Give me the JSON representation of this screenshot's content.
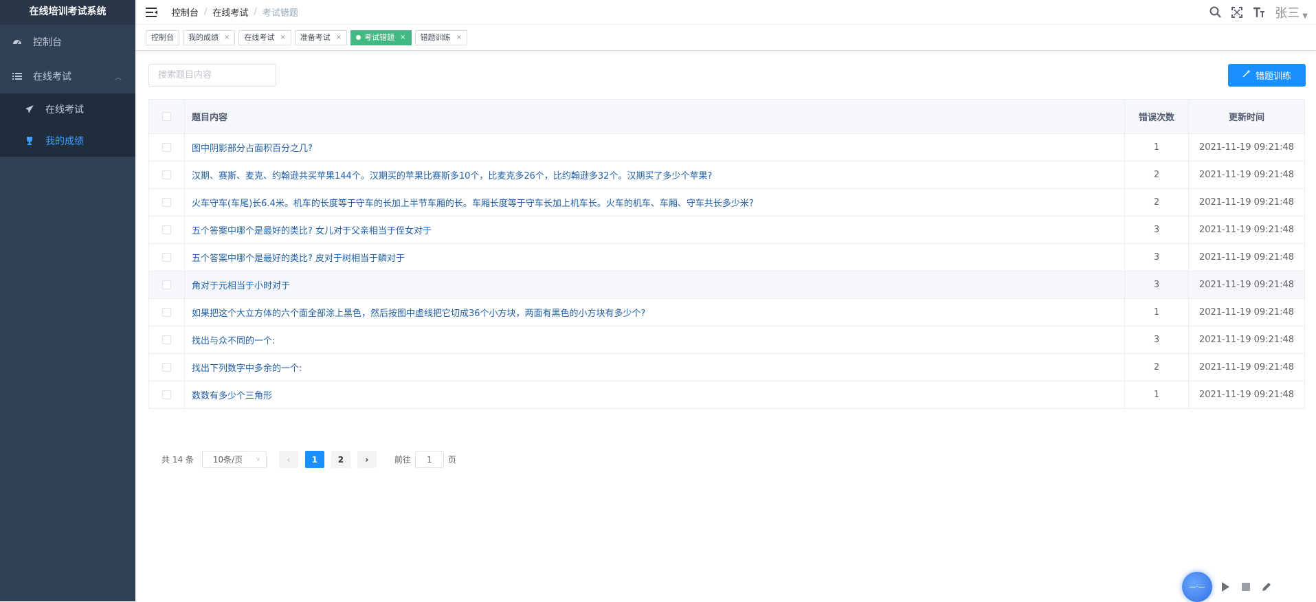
{
  "app": {
    "title": "在线培训考试系统"
  },
  "sidebar": {
    "items": [
      {
        "label": "控制台",
        "icon": "dashboard-icon"
      },
      {
        "label": "在线考试",
        "icon": "list-icon",
        "expanded": true,
        "children": [
          {
            "label": "在线考试",
            "icon": "paper-plane-icon"
          },
          {
            "label": "我的成绩",
            "icon": "trophy-icon",
            "active": true
          }
        ]
      }
    ]
  },
  "breadcrumb": [
    "控制台",
    "在线考试",
    "考试错题"
  ],
  "user": {
    "name": "张三"
  },
  "tags": [
    {
      "label": "控制台",
      "closable": false
    },
    {
      "label": "我的成绩",
      "closable": true
    },
    {
      "label": "在线考试",
      "closable": true
    },
    {
      "label": "准备考试",
      "closable": true
    },
    {
      "label": "考试错题",
      "closable": true,
      "active": true
    },
    {
      "label": "错题训练",
      "closable": true
    }
  ],
  "toolbar": {
    "search_placeholder": "搜索题目内容",
    "train_button": "错题训练"
  },
  "table": {
    "columns": {
      "title": "题目内容",
      "count": "错误次数",
      "time": "更新时间"
    },
    "rows": [
      {
        "title": "图中阴影部分占面积百分之几?",
        "count": "1",
        "time": "2021-11-19 09:21:48"
      },
      {
        "title": "汉期、赛斯、麦克、约翰逊共买苹果144个。汉期买的苹果比赛斯多10个，比麦克多26个，比约翰逊多32个。汉期买了多少个苹果?",
        "count": "2",
        "time": "2021-11-19 09:21:48"
      },
      {
        "title": "火车守车(车尾)长6.4米。机车的长度等于守车的长加上半节车厢的长。车厢长度等于守车长加上机车长。火车的机车、车厢、守车共长多少米?",
        "count": "2",
        "time": "2021-11-19 09:21:48"
      },
      {
        "title": "五个答案中哪个是最好的类比? 女儿对于父亲相当于侄女对于",
        "count": "3",
        "time": "2021-11-19 09:21:48"
      },
      {
        "title": "五个答案中哪个是最好的类比? 皮对于树相当于鳞对于",
        "count": "3",
        "time": "2021-11-19 09:21:48"
      },
      {
        "title": "角对于元相当于小时对于",
        "count": "3",
        "time": "2021-11-19 09:21:48"
      },
      {
        "title": "如果把这个大立方体的六个面全部涂上黑色，然后按图中虚线把它切成36个小方块，两面有黑色的小方块有多少个?",
        "count": "1",
        "time": "2021-11-19 09:21:48"
      },
      {
        "title": "找出与众不同的一个:",
        "count": "3",
        "time": "2021-11-19 09:21:48"
      },
      {
        "title": "找出下列数字中多余的一个:",
        "count": "2",
        "time": "2021-11-19 09:21:48"
      },
      {
        "title": "数数有多少个三角形",
        "count": "1",
        "time": "2021-11-19 09:21:48"
      }
    ]
  },
  "pagination": {
    "total_text": "共 14 条",
    "page_size": "10条/页",
    "pages": [
      "1",
      "2"
    ],
    "current": "1",
    "goto_prefix": "前往",
    "goto_value": "1",
    "goto_suffix": "页"
  },
  "colors": {
    "sidebar_bg": "#304156",
    "accent": "#1890ff",
    "active_tag": "#42b983"
  }
}
